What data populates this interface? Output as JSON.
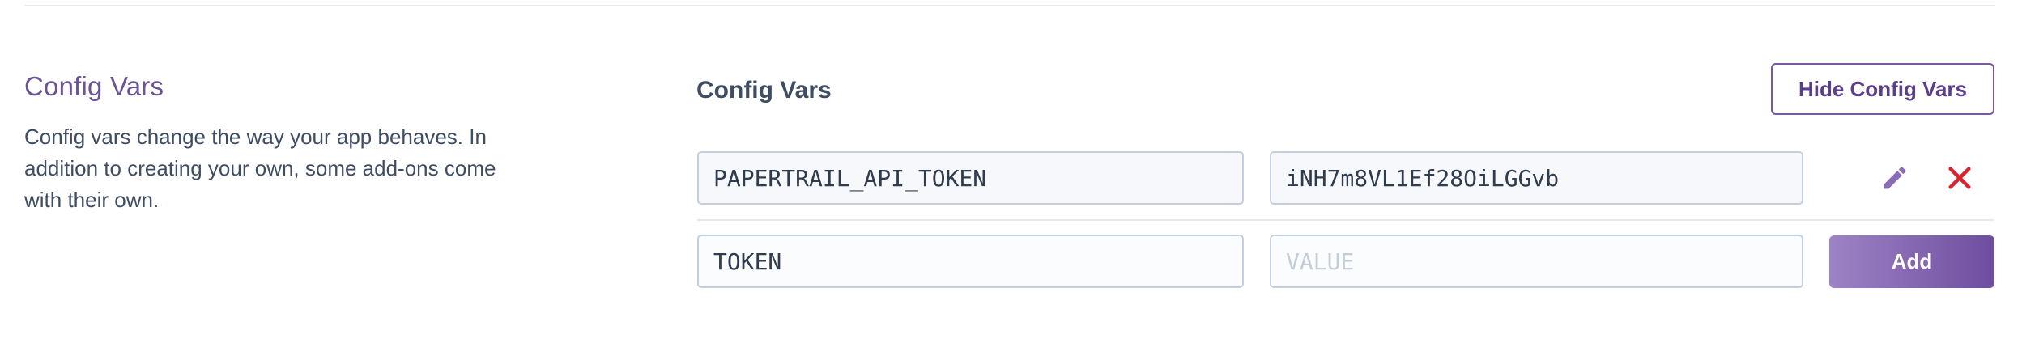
{
  "section": {
    "title": "Config Vars",
    "description": "Config vars change the way your app behaves. In addition to creating your own, some add-ons come with their own."
  },
  "panel": {
    "heading": "Config Vars",
    "hide_button_label": "Hide Config Vars"
  },
  "config_vars": [
    {
      "key": "PAPERTRAIL_API_TOKEN",
      "value": "iNH7m8VL1Ef28OiLGGvb"
    }
  ],
  "new_var": {
    "key_value": "TOKEN",
    "value_placeholder": "VALUE",
    "add_button_label": "Add"
  },
  "icons": {
    "edit": "pencil-icon",
    "delete": "close-x-icon"
  },
  "colors": {
    "accent_purple": "#79589f",
    "title_purple": "#6a5494",
    "delete_red": "#d9232f"
  }
}
